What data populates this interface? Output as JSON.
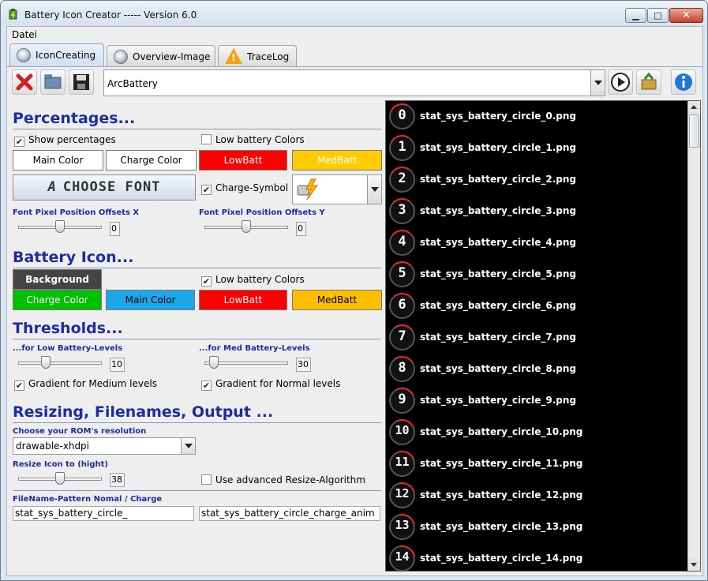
{
  "window": {
    "title": "Battery Icon Creator ----- Version 6.0"
  },
  "menu": {
    "items": [
      "Datei"
    ]
  },
  "tabs": [
    {
      "label": "IconCreating",
      "icon": "gear-cd-icon",
      "active": true
    },
    {
      "label": "Overview-Image",
      "icon": "gear-cd-icon"
    },
    {
      "label": "TraceLog",
      "icon": "warning-icon"
    }
  ],
  "toolbar": {
    "buttons": [
      "delete-icon",
      "open-folder-icon",
      "save-icon"
    ],
    "profile_value": "ArcBattery",
    "right_buttons": [
      "play-icon",
      "export-icon",
      "info-icon"
    ]
  },
  "percentages": {
    "title": "Percentages...",
    "show_percentages": "Show percentages",
    "low_battery_colors": "Low battery Colors",
    "main_color": "Main Color",
    "charge_color": "Charge Color",
    "lowbatt": "LowBatt",
    "medbatt": "MedBatt",
    "choose_font": "CHOOSE FONT",
    "charge_symbol": "Charge-Symbol",
    "offset_x_label": "Font Pixel Position Offsets X",
    "offset_x_value": "0",
    "offset_y_label": "Font Pixel Position Offsets Y",
    "offset_y_value": "0"
  },
  "battery_icon": {
    "title": "Battery Icon...",
    "background": "Background",
    "low_battery_colors": "Low battery Colors",
    "charge_color": "Charge Color",
    "main_color": "Main Color",
    "lowbatt": "LowBatt",
    "medbatt": "MedBatt"
  },
  "thresholds": {
    "title": "Thresholds...",
    "low_label": "...for Low Battery-Levels",
    "low_value": "10",
    "med_label": "...for Med Battery-Levels",
    "med_value": "30",
    "gradient_medium": "Gradient for Medium levels",
    "gradient_normal": "Gradient for Normal levels"
  },
  "resizing": {
    "title": "Resizing, Filenames, Output ...",
    "resolution_label": "Choose your ROM's resolution",
    "resolution_value": "drawable-xhdpi",
    "resize_label": "Resize Icon to (hight)",
    "resize_value": "38",
    "advanced_resize": "Use advanced Resize-Algorithm",
    "pattern_label": "FileName-Pattern Nomal / Charge",
    "pattern_normal": "stat_sys_battery_circle_",
    "pattern_charge": "stat_sys_battery_circle_charge_anim"
  },
  "preview_list": [
    {
      "num": "0",
      "file": "stat_sys_battery_circle_0.png"
    },
    {
      "num": "1",
      "file": "stat_sys_battery_circle_1.png"
    },
    {
      "num": "2",
      "file": "stat_sys_battery_circle_2.png"
    },
    {
      "num": "3",
      "file": "stat_sys_battery_circle_3.png"
    },
    {
      "num": "4",
      "file": "stat_sys_battery_circle_4.png"
    },
    {
      "num": "5",
      "file": "stat_sys_battery_circle_5.png"
    },
    {
      "num": "6",
      "file": "stat_sys_battery_circle_6.png"
    },
    {
      "num": "7",
      "file": "stat_sys_battery_circle_7.png"
    },
    {
      "num": "8",
      "file": "stat_sys_battery_circle_8.png"
    },
    {
      "num": "9",
      "file": "stat_sys_battery_circle_9.png"
    },
    {
      "num": "10",
      "file": "stat_sys_battery_circle_10.png"
    },
    {
      "num": "11",
      "file": "stat_sys_battery_circle_11.png"
    },
    {
      "num": "12",
      "file": "stat_sys_battery_circle_12.png"
    },
    {
      "num": "13",
      "file": "stat_sys_battery_circle_13.png"
    },
    {
      "num": "14",
      "file": "stat_sys_battery_circle_14.png"
    }
  ],
  "colors": {
    "low": "#ff0000",
    "med": "#ffcc00",
    "charge": "#00cc00",
    "main": "#22aaee",
    "background": "#444444",
    "heading": "#1b2e9c"
  }
}
